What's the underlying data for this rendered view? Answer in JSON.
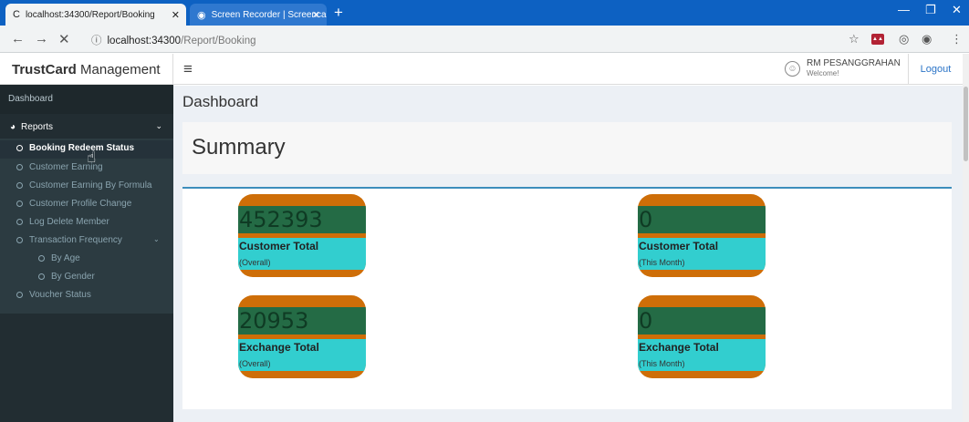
{
  "browser": {
    "tabs": [
      {
        "title": "localhost:34300/Report/Booking"
      },
      {
        "title": "Screen Recorder | Screencast-O..."
      }
    ],
    "address": {
      "host": "localhost:34300",
      "path": "/Report/Booking"
    }
  },
  "app": {
    "brand_bold": "TrustCard",
    "brand_rest": " Management",
    "user": {
      "name": "RM PESANGGRAHAN",
      "welcome": "Welcome!"
    },
    "logout_label": "Logout"
  },
  "sidebar": {
    "dashboard_label": "Dashboard",
    "reports_label": "Reports",
    "items": [
      {
        "label": "Booking Redeem Status",
        "active": true
      },
      {
        "label": "Customer Earning"
      },
      {
        "label": "Customer Earning By Formula"
      },
      {
        "label": "Customer Profile Change"
      },
      {
        "label": "Log Delete Member"
      },
      {
        "label": "Transaction Frequency"
      },
      {
        "label": "By Age"
      },
      {
        "label": "By Gender"
      },
      {
        "label": "Voucher Status"
      }
    ]
  },
  "content": {
    "page_title": "Dashboard",
    "summary_title": "Summary",
    "cards": [
      {
        "value": "452393",
        "title": "Customer Total",
        "sub": "(Overall)"
      },
      {
        "value": "0",
        "title": "Customer Total",
        "sub": "(This Month)"
      },
      {
        "value": "20953",
        "title": "Exchange Total",
        "sub": "(Overall)"
      },
      {
        "value": "0",
        "title": "Exchange Total",
        "sub": "(This Month)"
      }
    ]
  },
  "colors": {
    "card_orange": "#ce6e08",
    "card_green": "#246b45",
    "card_cyan": "#32cecf",
    "sidebar_bg": "#222d32",
    "accent": "#3c8dbc"
  },
  "icons": [
    "reload-icon",
    "back-arrow-icon",
    "forward-arrow-icon",
    "close-icon",
    "info-icon",
    "star-icon",
    "menu-icon",
    "user-icon",
    "dashboard-icon",
    "chevron-down-icon",
    "circle-icon",
    "hand-pointer-icon"
  ]
}
